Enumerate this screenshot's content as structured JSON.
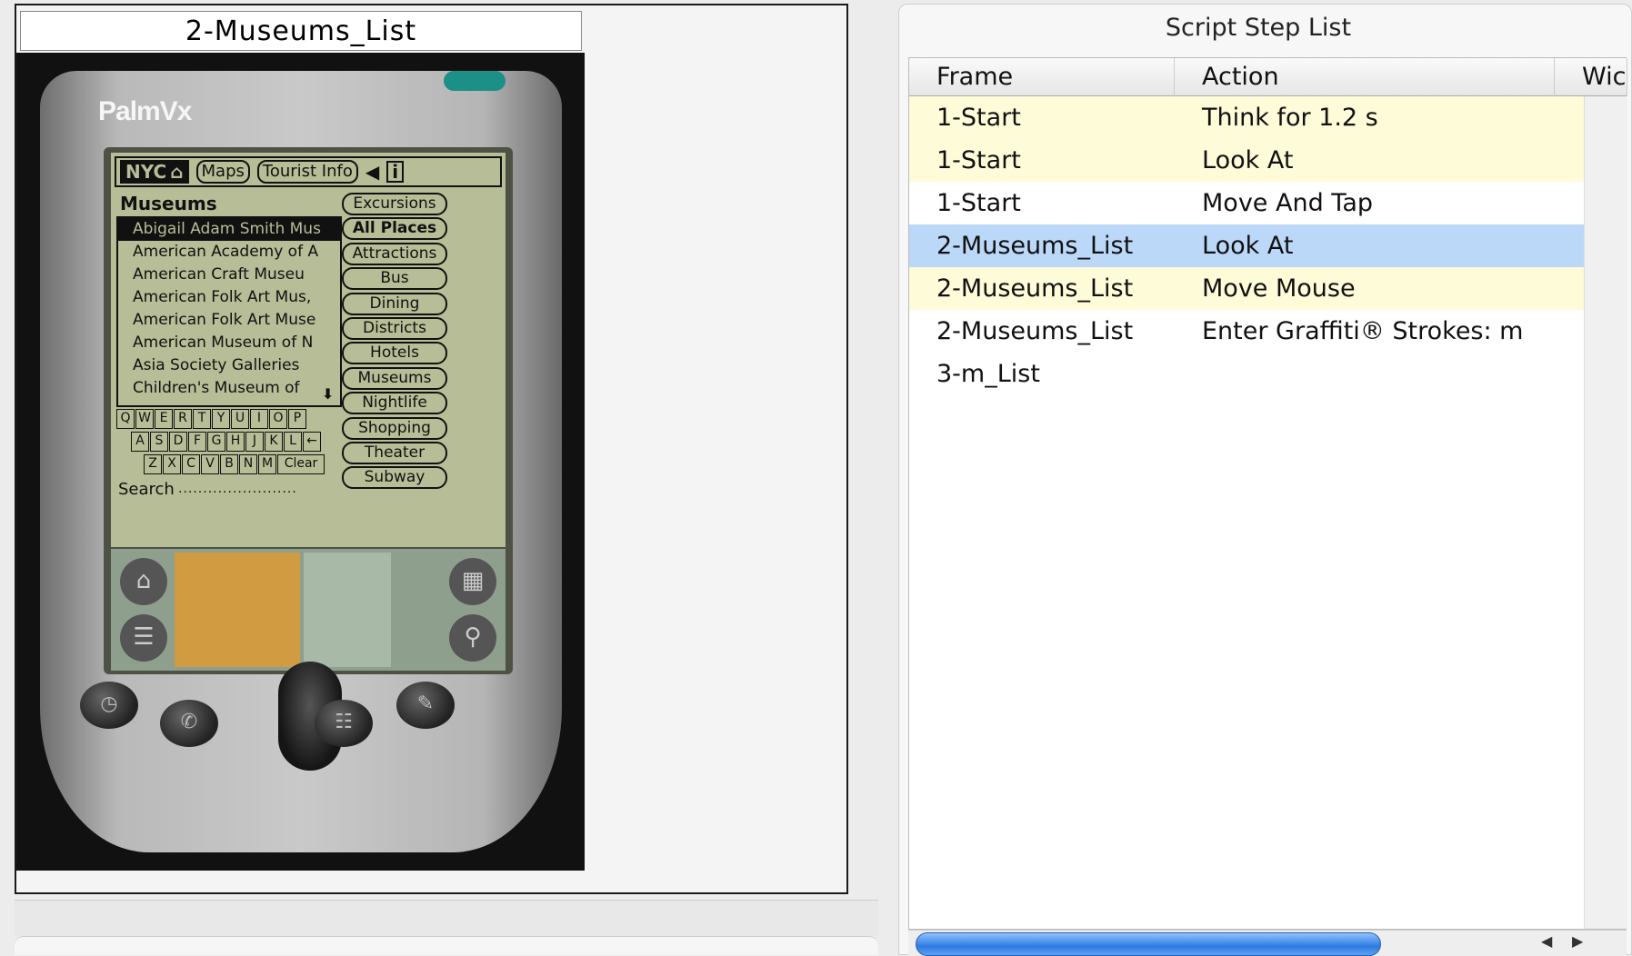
{
  "left": {
    "frame_title": "2-Museums_List",
    "device": {
      "brand": "PalmVx",
      "topbar": {
        "nyc": "NYC",
        "home_icon": "house-icon",
        "tab1": "Maps",
        "tab2": "Tourist Info",
        "back_icon": "arrow-left-icon",
        "info_icon": "info-icon",
        "info_glyph": "i"
      },
      "heading": "Museums",
      "list": [
        "Abigail Adam Smith Mus",
        "American Academy of A",
        "American Craft Museu",
        "American Folk Art Mus,",
        "American Folk Art Muse",
        "American Museum of N",
        "Asia Society Galleries",
        "Children's Museum of"
      ],
      "categories": [
        "Excursions",
        "All Places",
        "Attractions",
        "Bus",
        "Dining",
        "Districts",
        "Hotels",
        "Museums",
        "Nightlife",
        "Shopping",
        "Theater",
        "Subway"
      ],
      "keyboard": {
        "row1": [
          "Q",
          "W",
          "E",
          "R",
          "T",
          "Y",
          "U",
          "I",
          "O",
          "P"
        ],
        "row2": [
          "A",
          "S",
          "D",
          "F",
          "G",
          "H",
          "J",
          "K",
          "L",
          "←"
        ],
        "row3": [
          "Z",
          "X",
          "C",
          "V",
          "B",
          "N",
          "M",
          "Clear"
        ]
      },
      "search_label": "Search",
      "search_dots": "........................"
    }
  },
  "right": {
    "title": "Script Step List",
    "columns": [
      "Frame",
      "Action",
      "Wic"
    ],
    "rows": [
      {
        "frame": "1-Start",
        "action": "Think for 1.2 s"
      },
      {
        "frame": "1-Start",
        "action": "Look At"
      },
      {
        "frame": "1-Start",
        "action": "Move And Tap"
      },
      {
        "frame": "2-Museums_List",
        "action": "Look At"
      },
      {
        "frame": "2-Museums_List",
        "action": "Move Mouse"
      },
      {
        "frame": "2-Museums_List",
        "action": "Enter Graffiti® Strokes: m"
      },
      {
        "frame": "3-m_List",
        "action": ""
      }
    ],
    "colors": {
      "highlight_yellow": "#fdfbd8",
      "selected_blue": "#bcd8f8"
    }
  }
}
